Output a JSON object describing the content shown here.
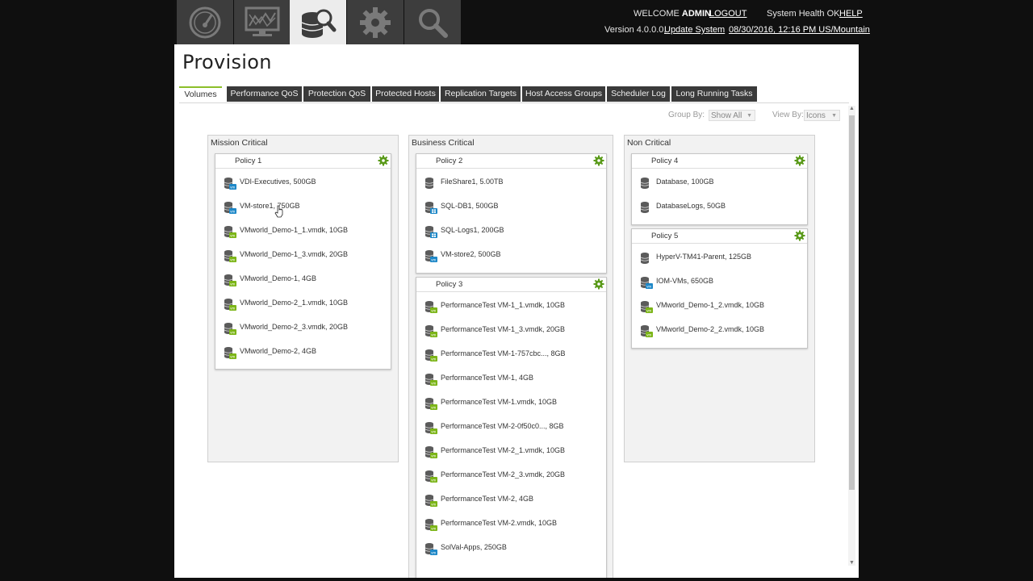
{
  "header": {
    "nav_tabs": [
      {
        "icon": "dashboard-gauge-icon",
        "active": false
      },
      {
        "icon": "monitor-chart-icon",
        "active": false
      },
      {
        "icon": "provision-database-icon",
        "active": true
      },
      {
        "icon": "gear-icon",
        "active": false
      },
      {
        "icon": "search-icon",
        "active": false
      }
    ],
    "welcome": "WELCOME",
    "username": "ADMIN",
    "logout": "LOGOUT",
    "system_health": "System Health OK",
    "help": "HELP",
    "version": "Version 4.0.0.0,",
    "update_system": "Update System",
    "datetime": "08/30/2016, 12:16 PM US/Mountain"
  },
  "page": {
    "title": "Provision",
    "tabs": [
      {
        "label": "Volumes",
        "active": true
      },
      {
        "label": "Performance QoS",
        "active": false
      },
      {
        "label": "Protection QoS",
        "active": false
      },
      {
        "label": "Protected Hosts",
        "active": false
      },
      {
        "label": "Replication Targets",
        "active": false
      },
      {
        "label": "Host Access Groups",
        "active": false
      },
      {
        "label": "Scheduler Log",
        "active": false
      },
      {
        "label": "Long Running Tasks",
        "active": false
      }
    ],
    "group_by_label": "Group By:",
    "group_by_value": "Show All",
    "view_by_label": "View By:",
    "view_by_value": "Icons"
  },
  "groups": [
    {
      "title": "Mission Critical",
      "policies": [
        {
          "name": "Policy 1",
          "volumes": [
            {
              "label": "VDI-Executives, 500GB",
              "badge": "vmware-blue"
            },
            {
              "label": "VM-store1, 750GB",
              "badge": "vmware-blue"
            },
            {
              "label": "VMworld_Demo-1_1.vmdk, 10GB",
              "badge": "vm-green"
            },
            {
              "label": "VMworld_Demo-1_3.vmdk, 20GB",
              "badge": "vm-green"
            },
            {
              "label": "VMworld_Demo-1, 4GB",
              "badge": "vm-green"
            },
            {
              "label": "VMworld_Demo-2_1.vmdk, 10GB",
              "badge": "vm-green"
            },
            {
              "label": "VMworld_Demo-2_3.vmdk, 20GB",
              "badge": "vm-green"
            },
            {
              "label": "VMworld_Demo-2, 4GB",
              "badge": "vm-green"
            }
          ]
        }
      ]
    },
    {
      "title": "Business Critical",
      "policies": [
        {
          "name": "Policy 2",
          "volumes": [
            {
              "label": "FileShare1, 5.00TB",
              "badge": "none"
            },
            {
              "label": "SQL-DB1, 500GB",
              "badge": "windows-blue"
            },
            {
              "label": "SQL-Logs1, 200GB",
              "badge": "windows-blue"
            },
            {
              "label": "VM-store2, 500GB",
              "badge": "vmware-blue"
            }
          ]
        },
        {
          "name": "Policy 3",
          "volumes": [
            {
              "label": "PerformanceTest VM-1_1.vmdk, 10GB",
              "badge": "vm-green"
            },
            {
              "label": "PerformanceTest VM-1_3.vmdk, 20GB",
              "badge": "vm-green"
            },
            {
              "label": "PerformanceTest VM-1-757cbc..., 8GB",
              "badge": "vm-green"
            },
            {
              "label": "PerformanceTest VM-1, 4GB",
              "badge": "vm-green"
            },
            {
              "label": "PerformanceTest VM-1.vmdk, 10GB",
              "badge": "vm-green"
            },
            {
              "label": "PerformanceTest VM-2-0f50c0..., 8GB",
              "badge": "vm-green"
            },
            {
              "label": "PerformanceTest VM-2_1.vmdk, 10GB",
              "badge": "vm-green"
            },
            {
              "label": "PerformanceTest VM-2_3.vmdk, 20GB",
              "badge": "vm-green"
            },
            {
              "label": "PerformanceTest VM-2, 4GB",
              "badge": "vm-green"
            },
            {
              "label": "PerformanceTest VM-2.vmdk, 10GB",
              "badge": "vm-green"
            },
            {
              "label": "SolVal-Apps, 250GB",
              "badge": "vmware-blue"
            }
          ]
        }
      ]
    },
    {
      "title": "Non Critical",
      "policies": [
        {
          "name": "Policy 4",
          "volumes": [
            {
              "label": "Database, 100GB",
              "badge": "none"
            },
            {
              "label": "DatabaseLogs, 50GB",
              "badge": "none"
            }
          ]
        },
        {
          "name": "Policy 5",
          "volumes": [
            {
              "label": "HyperV-TM41-Parent, 125GB",
              "badge": "none"
            },
            {
              "label": "IOM-VMs, 650GB",
              "badge": "vmware-blue"
            },
            {
              "label": "VMworld_Demo-1_2.vmdk, 10GB",
              "badge": "vm-green"
            },
            {
              "label": "VMworld_Demo-2_2.vmdk, 10GB",
              "badge": "vm-green"
            }
          ]
        }
      ]
    }
  ],
  "colors": {
    "accent_green": "#8cbf2a",
    "vmware_blue": "#1e88c8",
    "header_bg": "#101010",
    "nav_tab_bg": "#3d3d3d",
    "subtab_bg": "#3a3a3a"
  }
}
